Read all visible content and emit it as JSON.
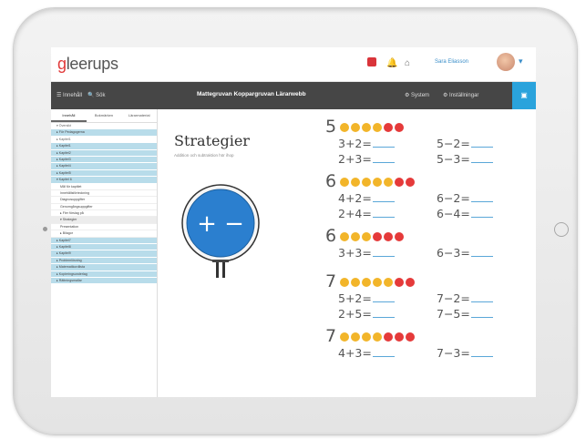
{
  "app": {
    "logo_prefix": "g",
    "logo_rest": "leerups"
  },
  "topbar": {
    "user_name": "Sara Eliasson",
    "chev": "▾",
    "badge_label": "■",
    "bell": "🔔",
    "home": "⌂"
  },
  "navbar": {
    "left1": "☰ Innehåll",
    "left2": "🔍 Sök",
    "title": "Mattegruvan Koppargruvan Lärarwebb",
    "right1": "⚙ System",
    "right2": "⚙ Inställningar",
    "blue_btn": "▣"
  },
  "sidebar": {
    "tabs": [
      "Innehåll",
      "Bokmärken",
      "Lärarmaterial"
    ],
    "rows": [
      {
        "label": "▾ Översikt",
        "style": "white"
      },
      {
        "label": "▸ För Pedagogerna",
        "style": "blue"
      },
      {
        "label": "▸ Kapitel1",
        "style": "white"
      },
      {
        "label": "▸ Kapitel1",
        "style": "blue"
      },
      {
        "label": "▸ Kapitel2",
        "style": "blue"
      },
      {
        "label": "▸ Kapitel3",
        "style": "blue"
      },
      {
        "label": "▸ Kapitel4",
        "style": "blue"
      },
      {
        "label": "▸ Kapitel5",
        "style": "blue"
      },
      {
        "label": "▾ Kapitel 6",
        "style": "blue"
      },
      {
        "label": "Mål för kapitlet",
        "style": "sub"
      },
      {
        "label": "Innehållsförteckning",
        "style": "sub"
      },
      {
        "label": "Diagnosuppgifter",
        "style": "sub"
      },
      {
        "label": "Genomgångsuppgifter",
        "style": "sub"
      },
      {
        "label": "▸ Fler förslag på",
        "style": "sub"
      },
      {
        "label": "▾ Strategier",
        "style": "sub sel"
      },
      {
        "label": "Presentation",
        "style": "sub"
      },
      {
        "label": "▸ Bilagor",
        "style": "sub"
      },
      {
        "label": "▸ Kapitel7",
        "style": "blue"
      },
      {
        "label": "▸ Kapitel8",
        "style": "blue"
      },
      {
        "label": "▸ Kapitel9",
        "style": "blue"
      },
      {
        "label": "▸ Problemlösning",
        "style": "blue"
      },
      {
        "label": "▸ Matematikordlista",
        "style": "blue"
      },
      {
        "label": "▸ Kopieringsunderlag",
        "style": "blue"
      },
      {
        "label": "▸ Rättningsmallar",
        "style": "blue"
      }
    ]
  },
  "main": {
    "title": "Strategier",
    "subtitle": "Addition och subtraktion hör ihop",
    "sign_text": "+ −",
    "blocks": [
      {
        "number": "5",
        "yellow": 4,
        "red": 2,
        "eqs": [
          [
            "3+2=",
            "5−2="
          ],
          [
            "2+3=",
            "5−3="
          ]
        ]
      },
      {
        "number": "6",
        "yellow": 5,
        "red": 2,
        "eqs": [
          [
            "4+2=",
            "6−2="
          ],
          [
            "2+4=",
            "6−4="
          ]
        ]
      },
      {
        "number": "6",
        "yellow": 3,
        "red": 3,
        "eqs": [
          [
            "3+3=",
            "6−3="
          ]
        ]
      },
      {
        "number": "7",
        "yellow": 5,
        "red": 2,
        "eqs": [
          [
            "5+2=",
            "7−2="
          ],
          [
            "2+5=",
            "7−5="
          ]
        ]
      },
      {
        "number": "7",
        "yellow": 4,
        "red": 3,
        "eqs": [
          [
            "4+3=",
            "7−3="
          ]
        ]
      }
    ]
  },
  "colors": {
    "accent": "#2aa3dc",
    "nav_bg": "#464646",
    "sidebar_blue": "#b8dcea",
    "dot_yellow": "#f2b52a",
    "dot_red": "#e53a3a"
  }
}
